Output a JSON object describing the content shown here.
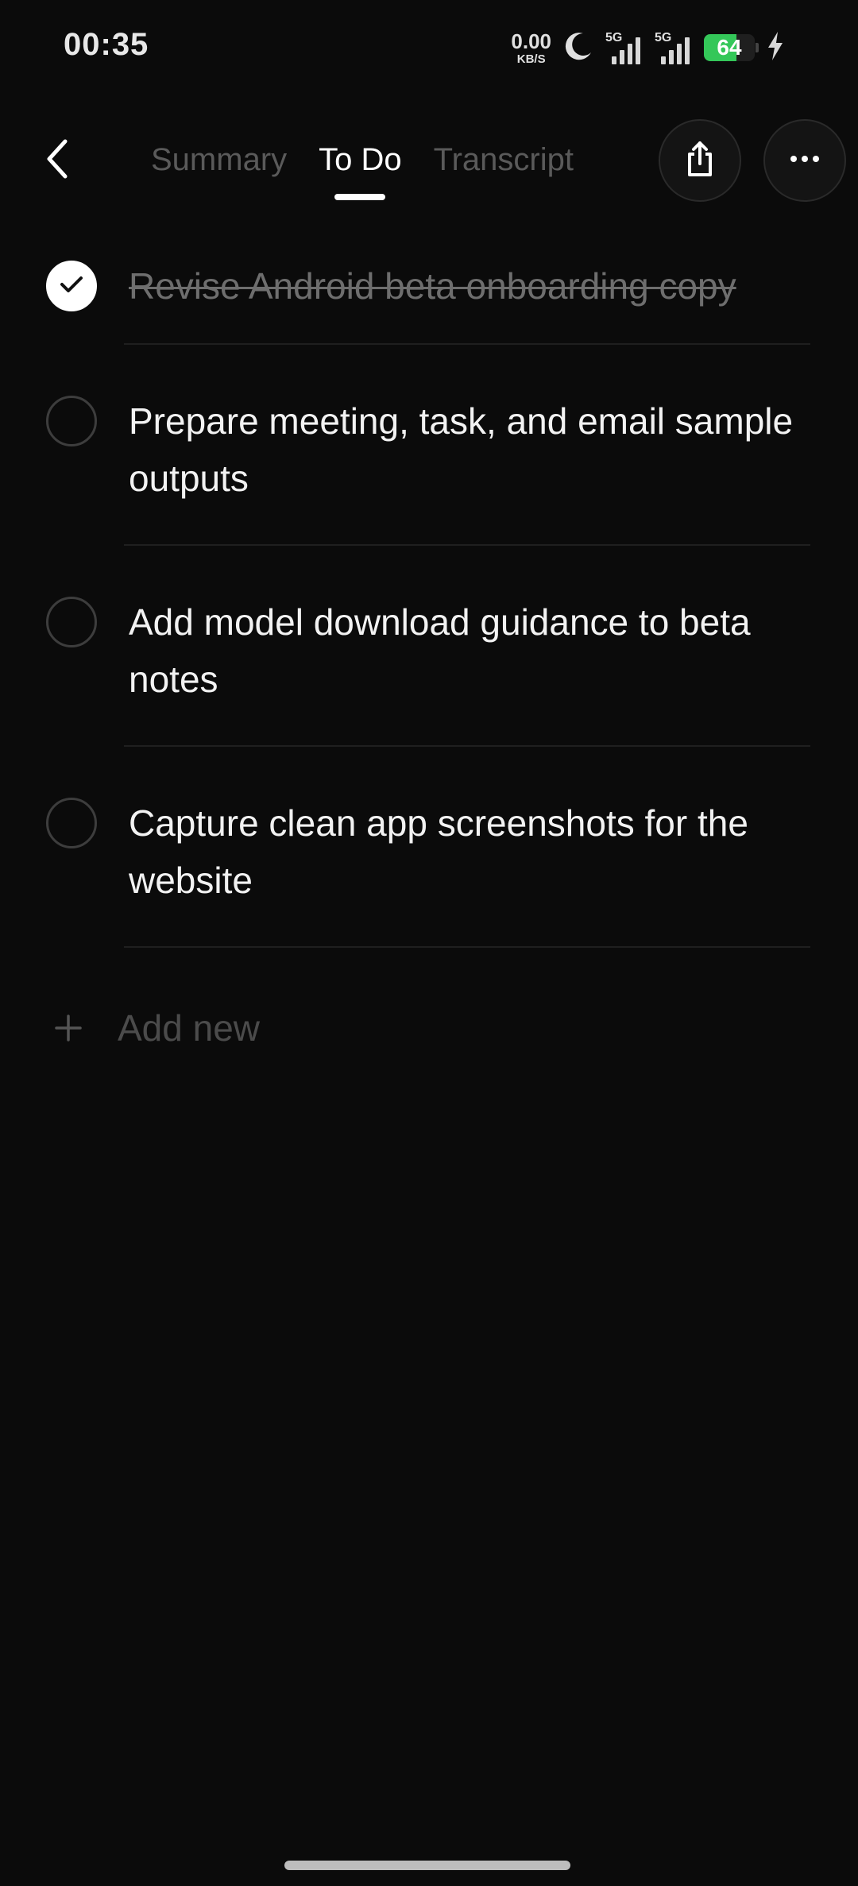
{
  "status_bar": {
    "time": "00:35",
    "net_speed_value": "0.00",
    "net_speed_unit": "KB/S",
    "sim1_gen": "5G",
    "sim2_gen": "5G",
    "battery_percent": "64",
    "battery_color": "#34c759",
    "icons": [
      "moon-icon",
      "signal-icon",
      "signal-icon",
      "battery-icon",
      "charging-icon"
    ]
  },
  "header": {
    "tabs": [
      {
        "label": "Summary",
        "active": false
      },
      {
        "label": "To Do",
        "active": true
      },
      {
        "label": "Transcript",
        "active": false
      }
    ],
    "icons": [
      "back-chevron-icon",
      "share-icon",
      "more-icon"
    ]
  },
  "tasks": [
    {
      "text": "Revise Android beta onboarding copy",
      "completed": true
    },
    {
      "text": "Prepare meeting, task, and email sample outputs",
      "completed": false
    },
    {
      "text": "Add model download guidance to beta notes",
      "completed": false
    },
    {
      "text": "Capture clean app screenshots for the website",
      "completed": false
    }
  ],
  "add_new": {
    "label": "Add new",
    "icon": "plus-icon"
  }
}
